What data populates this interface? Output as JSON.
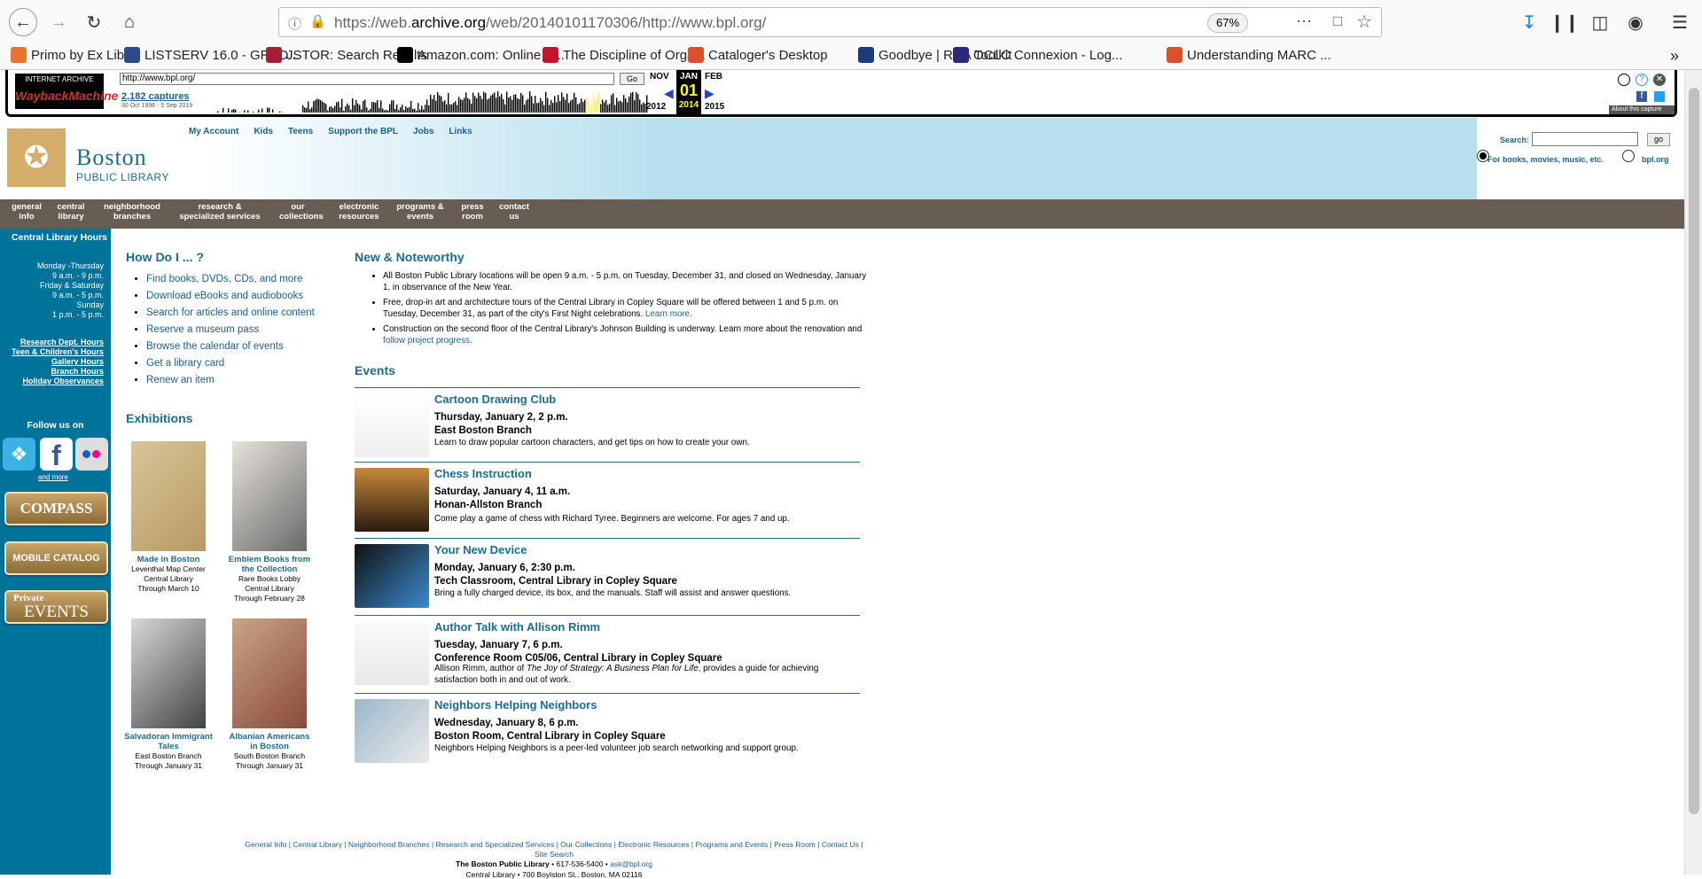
{
  "browser": {
    "url_prefix": "https://web.",
    "url_domain": "archive.org",
    "url_rest": "/web/20140101170306/http://www.bpl.org/",
    "zoom": "67%",
    "bookmarks": [
      {
        "label": "Primo by Ex Libris",
        "icon_color": "#e8732a"
      },
      {
        "label": "LISTSERV 16.0 - GRAD...",
        "icon_color": "#2d4a8a"
      },
      {
        "label": "JSTOR: Search Results",
        "icon_color": "#a31f34"
      },
      {
        "label": "Amazon.com: Online S...",
        "icon_color": "#000000"
      },
      {
        "label": "The Discipline of Orga...",
        "icon_color": "#c4122f"
      },
      {
        "label": "Cataloger's Desktop",
        "icon_color": "#d9502b"
      },
      {
        "label": "Goodbye | RDA Toolkit",
        "icon_color": "#1c3b7a"
      },
      {
        "label": "OCLC Connexion - Log...",
        "icon_color": "#2a2a7a"
      },
      {
        "label": "Understanding MARC ...",
        "icon_color": "#d9502b"
      }
    ]
  },
  "wayback": {
    "logo_top": "INTERNET ARCHIVE",
    "logo_main": "WaybackMachine",
    "url": "http://www.bpl.org/",
    "go": "Go",
    "captures": "2,182 captures",
    "range": "30 Oct 1996 - 5 Sep 2019",
    "months": {
      "prev": "NOV",
      "cur": "JAN",
      "next": "FEB"
    },
    "day": "01",
    "years": {
      "prev": "2012",
      "cur": "2014",
      "next": "2015"
    },
    "about": "About this capture"
  },
  "site": {
    "logo_title": "Boston",
    "logo_sub": "PUBLIC LIBRARY",
    "top_links": [
      "My Account",
      "Kids",
      "Teens",
      "Support the BPL",
      "Jobs",
      "Links"
    ],
    "search_label": "Search:",
    "search_go": "go",
    "radio_books": "For books, movies, music, etc.",
    "radio_site": "bpl.org",
    "nav": [
      {
        "l1": "general",
        "l2": "info"
      },
      {
        "l1": "central",
        "l2": "library"
      },
      {
        "l1": "neighborhood",
        "l2": "branches"
      },
      {
        "l1": "research &",
        "l2": "specialized services"
      },
      {
        "l1": "our",
        "l2": "collections"
      },
      {
        "l1": "electronic",
        "l2": "resources"
      },
      {
        "l1": "programs &",
        "l2": "events"
      },
      {
        "l1": "press",
        "l2": "room"
      },
      {
        "l1": "contact",
        "l2": "us"
      }
    ],
    "sidebar": {
      "hours_title": "Central Library Hours",
      "hours": [
        "Monday -Thursday",
        "9 a.m. - 9 p.m.",
        "Friday & Saturday",
        "9 a.m. - 5 p.m.",
        "Sunday",
        "1 p.m. - 5 p.m."
      ],
      "links": [
        "Research Dept. Hours",
        "Teen & Children's Hours",
        "Gallery Hours",
        "Branch Hours",
        "Holiday Observances"
      ],
      "follow": "Follow us on",
      "and_more": "and more",
      "compass": "COMPASS",
      "mobile": "MOBILE CATALOG",
      "private_top": "Private",
      "private_main": "EVENTS"
    },
    "how_title": "How Do I ... ?",
    "how_items": [
      "Find books, DVDs, CDs, and more",
      "Download eBooks and audiobooks",
      "Search for articles and online content",
      "Reserve a museum pass",
      "Browse the calendar of events",
      "Get a library card",
      "Renew an item"
    ],
    "exhibitions_title": "Exhibitions",
    "exhibitions": [
      {
        "name": "Made in Boston",
        "lines": [
          "Leventhal Map Center",
          "Central Library",
          "Through March 10"
        ]
      },
      {
        "name": "Emblem Books from the Collection",
        "lines": [
          "Rare Books Lobby",
          "Central Library",
          "Through February 28"
        ]
      },
      {
        "name": "Salvadoran Immigrant Tales",
        "lines": [
          "East Boston Branch",
          "Through January 31"
        ]
      },
      {
        "name": "Albanian Americans in Boston",
        "lines": [
          "South Boston Branch",
          "Through January 31"
        ]
      }
    ],
    "news_title": "New & Noteworthy",
    "news": [
      {
        "text": "All Boston Public Library locations will be open 9 a.m. - 5 p.m. on Tuesday, December 31, and closed on Wednesday, January 1, in observance of the New Year.",
        "link": ""
      },
      {
        "text": "Free, drop-in art and architecture tours of the Central Library in Copley Square will be offered between 1 and 5 p.m. on Tuesday, December 31, as part of the city's First Night celebrations.",
        "link": "Learn more."
      },
      {
        "text": "Construction on the second floor of the Central Library's Johnson Building is underway. Learn more about the renovation and",
        "link": "follow project progress."
      }
    ],
    "events_title": "Events",
    "events": [
      {
        "title": "Cartoon Drawing Club",
        "date": "Thursday, January 2, 2 p.m.",
        "place": "East Boston Branch",
        "desc": "Learn to draw popular cartoon characters, and get tips on how to create your own."
      },
      {
        "title": "Chess Instruction",
        "date": "Saturday, January 4, 11 a.m.",
        "place": "Honan-Allston Branch",
        "desc": "Come play a game of chess with Richard Tyree. Beginners are welcome. For ages 7 and up."
      },
      {
        "title": "Your New Device",
        "date": "Monday, January 6, 2:30 p.m.",
        "place": "Tech Classroom, Central Library in Copley Square",
        "desc": "Bring a fully charged device, its box, and the manuals. Staff will assist and answer questions."
      },
      {
        "title": "Author Talk with Allison Rimm",
        "date": "Tuesday, January 7, 6 p.m.",
        "place": "Conference Room C05/06, Central Library in Copley Square",
        "desc_a": "Allison Rimm, author of ",
        "desc_i": "The Joy of Strategy: A Business Plan for Life",
        "desc_b": ", provides a guide for achieving satisfaction both in and out of work."
      },
      {
        "title": "Neighbors Helping Neighbors",
        "date": "Wednesday, January 8, 6 p.m.",
        "place": "Boston Room, Central Library in Copley Square",
        "desc": "Neighbors Helping Neighbors is a peer-led volunteer job search networking and support group."
      }
    ],
    "footer_links": "General Info | Central Library | Neighborhood Branches | Research and Specialized Services | Our Collections | Electronic Resources | Programs and Events | Press Room | Contact Us | Site Search",
    "footer_org": "The Boston Public Library",
    "footer_phone": " • 617-536-5400 • ",
    "footer_email": "ask@bpl.org",
    "footer_addr": "Central Library • 700 Boylston St., Boston, MA 02116"
  }
}
